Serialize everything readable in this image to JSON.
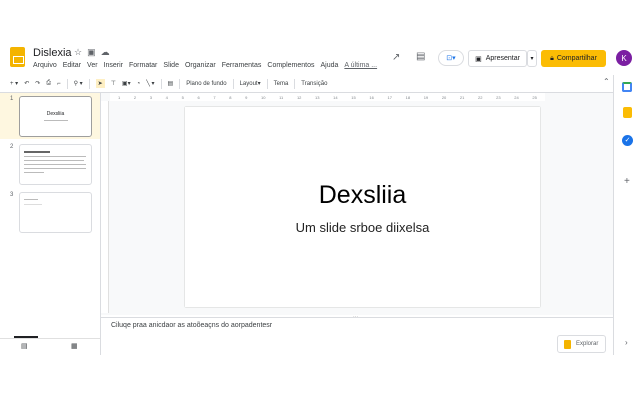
{
  "app": {
    "title": "Dislexia"
  },
  "menu": [
    "Arquivo",
    "Editar",
    "Ver",
    "Inserir",
    "Formatar",
    "Slide",
    "Organizar",
    "Ferramentas",
    "Complementos",
    "Ajuda"
  ],
  "menu_last_edit": "A última ...",
  "toolbar": {
    "background": "Plano de fundo",
    "layout": "Layout",
    "theme": "Tema",
    "transition": "Transição"
  },
  "header": {
    "present": "Apresentar",
    "share": "Compartilhar",
    "avatar": "K"
  },
  "ruler": [
    "1",
    "2",
    "3",
    "4",
    "5",
    "6",
    "7",
    "8",
    "9",
    "10",
    "11",
    "12",
    "13",
    "14",
    "15",
    "16",
    "17",
    "18",
    "19",
    "20",
    "21",
    "22",
    "23",
    "24",
    "25"
  ],
  "slides": [
    {
      "number": "1"
    },
    {
      "number": "2"
    },
    {
      "number": "3"
    }
  ],
  "current_slide": {
    "title": "Dexsliia",
    "subtitle": "Um slide srboe diixelsa"
  },
  "notes": {
    "placeholder": "Ciluqe praa anicdaor as atoõeaçns do aorpadentesr"
  },
  "explore": "Explorar",
  "colors": {
    "brand": "#f4b400",
    "share": "#fbbc04",
    "avatar": "#7b1fa2",
    "selected": "#fef7e0"
  }
}
